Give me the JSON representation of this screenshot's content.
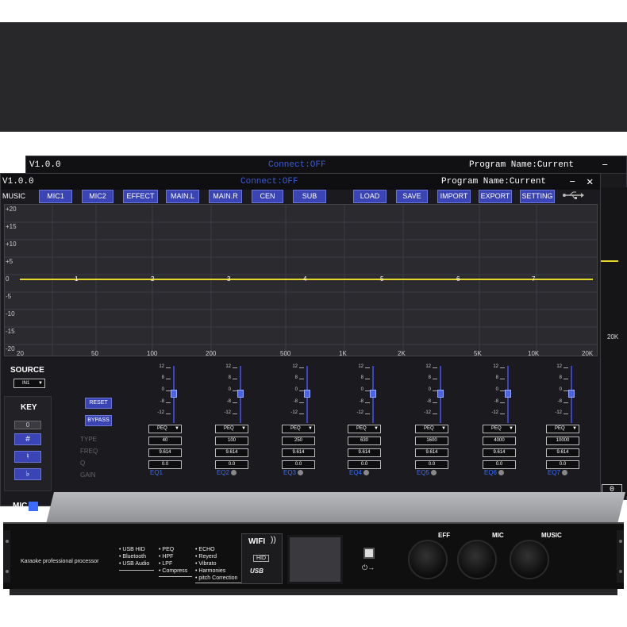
{
  "back_window": {
    "version": "V1.0.0",
    "connect": "Connect:OFF",
    "program": "Program Name:Current",
    "close": "✕",
    "minimize": "–",
    "freq_label": "20K",
    "box_value": "0"
  },
  "front_window": {
    "version": "V1.0.0",
    "connect": "Connect:OFF",
    "program": "Program Name:Current",
    "minimize": "–",
    "close": "✕"
  },
  "toolbar": {
    "music_label": "MUSIC",
    "buttons": [
      "MIC1",
      "MIC2",
      "EFFECT",
      "MAIN.L",
      "MAIN.R",
      "CEN",
      "SUB",
      "LOAD",
      "SAVE",
      "IMPORT",
      "EXPORT",
      "SETTING"
    ],
    "usb_icon": "usb-icon"
  },
  "graph": {
    "y_labels": [
      "+20",
      "+15",
      "+10",
      "+5",
      "0",
      "-5",
      "-10",
      "-15",
      "-20"
    ],
    "x_labels": [
      "20",
      "50",
      "100",
      "200",
      "500",
      "1K",
      "2K",
      "5K",
      "10K",
      "20K"
    ],
    "points": [
      "1",
      "2",
      "3",
      "4",
      "5",
      "6",
      "7"
    ],
    "curve_color": "#e6d82a"
  },
  "source": {
    "label": "SOURCE",
    "value": "IN1"
  },
  "key": {
    "label": "KEY",
    "value": "0",
    "buttons": [
      "#",
      "♮",
      "♭"
    ]
  },
  "controls": {
    "reset": "RESET",
    "bypass": "BYPASS"
  },
  "params": [
    "TYPE",
    "FREQ",
    "Q",
    "GAIN"
  ],
  "scale": [
    "12",
    "8",
    "0",
    "-8",
    "-12"
  ],
  "bands": [
    {
      "name": "EQ1",
      "type": "PEQ",
      "freq": "40",
      "q": "9.614",
      "gain": "0.0"
    },
    {
      "name": "EQ2",
      "type": "PEQ",
      "freq": "100",
      "q": "9.614",
      "gain": "0.0"
    },
    {
      "name": "EQ3",
      "type": "PEQ",
      "freq": "250",
      "q": "9.614",
      "gain": "0.0"
    },
    {
      "name": "EQ4",
      "type": "PEQ",
      "freq": "630",
      "q": "9.614",
      "gain": "0.0"
    },
    {
      "name": "EQ5",
      "type": "PEQ",
      "freq": "1600",
      "q": "9.614",
      "gain": "0.0"
    },
    {
      "name": "EQ6",
      "type": "PEQ",
      "freq": "4000",
      "q": "9.614",
      "gain": "0.0"
    },
    {
      "name": "EQ7",
      "type": "PEQ",
      "freq": "10000",
      "q": "9.614",
      "gain": "0.0"
    }
  ],
  "mic_label": "MIC",
  "front_box_value": "0",
  "device": {
    "name": "Karaoke professional processor",
    "features_col1": [
      "USB HID",
      "Bluetooth",
      "USB Audio"
    ],
    "features_col2": [
      "PEQ",
      "HPF",
      "LPF",
      "Compress"
    ],
    "features_col3": [
      "ECHO",
      "Reyerd",
      "Vibrato",
      "Harmonies",
      "pitch Correction"
    ],
    "wifi": "WIFI",
    "hid": "HID",
    "usb": "USB",
    "knobs": [
      "EFF",
      "MIC",
      "MUSIC"
    ]
  }
}
